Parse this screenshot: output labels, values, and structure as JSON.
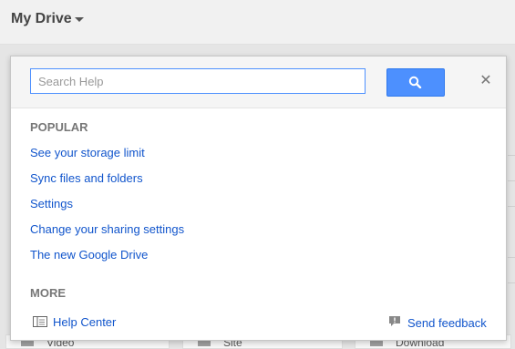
{
  "header": {
    "title": "My Drive"
  },
  "background": {
    "cards": [
      {
        "label": "Video"
      },
      {
        "label": "Site"
      },
      {
        "label": "Download"
      }
    ]
  },
  "help_panel": {
    "search": {
      "placeholder": "Search Help",
      "value": ""
    },
    "popular": {
      "heading": "POPULAR",
      "links": [
        "See your storage limit",
        "Sync files and folders",
        "Settings",
        "Change your sharing settings",
        "The new Google Drive"
      ]
    },
    "more": {
      "heading": "MORE",
      "help_center": "Help Center",
      "send_feedback": "Send feedback"
    }
  },
  "colors": {
    "accent": "#4d90fe",
    "link": "#1155cc"
  }
}
